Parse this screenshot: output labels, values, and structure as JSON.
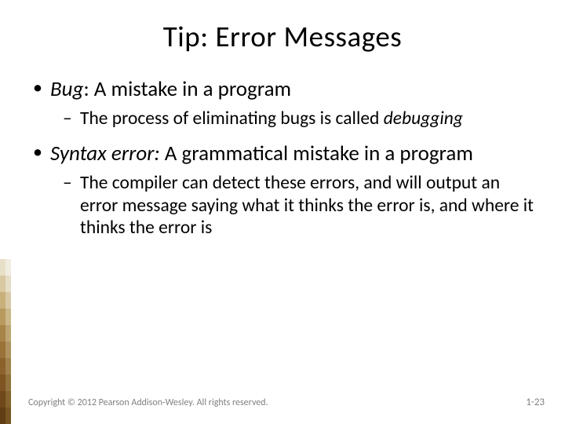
{
  "title": "Tip:  Error Messages",
  "bullets": {
    "b1a_term": "Bug",
    "b1a_rest": ":  A mistake in a program",
    "b2a_lead": "The process of eliminating bugs is called ",
    "b2a_ital": "debugging",
    "b1b_term": "Syntax error:",
    "b1b_rest": "  A grammatical mistake in a program",
    "b2b": "The compiler can detect these errors, and will output an error message saying what it thinks the error is, and where it thinks the error is"
  },
  "footer": "Copyright © 2012 Pearson Addison-Wesley. All rights reserved.",
  "pagenum": "1-23",
  "deco_colors_a": [
    "#e8dfc8",
    "#d9c9a3",
    "#c8b07a",
    "#b89a5e",
    "#a88448",
    "#9a7238",
    "#8c622c",
    "#7d5422",
    "#6f471a",
    "#623c14"
  ],
  "deco_colors_b": [
    "#f0ece0",
    "#e6ddc6",
    "#d8c9a6",
    "#cab78a",
    "#bca572",
    "#ae935e",
    "#a0824c",
    "#92723c",
    "#84632e",
    "#765522"
  ]
}
